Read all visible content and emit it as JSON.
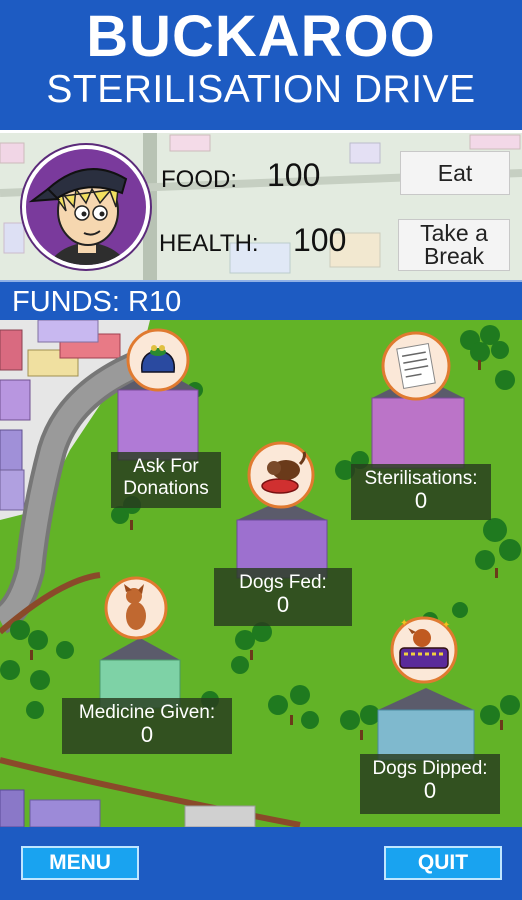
{
  "header": {
    "title": "BUCKAROO",
    "subtitle": "STERILISATION DRIVE"
  },
  "stats": {
    "food_label": "FOOD:",
    "food_value": "100",
    "health_label": "HEALTH:",
    "health_value": "100",
    "eat_label": "Eat",
    "break_line1": "Take a",
    "break_line2": "Break"
  },
  "funds": "FUNDS: R10",
  "buildings": {
    "donations_line1": "Ask For",
    "donations_line2": "Donations",
    "sterilisations_label": "Sterilisations:",
    "sterilisations_value": "0",
    "dogs_fed_label": "Dogs Fed:",
    "dogs_fed_value": "0",
    "medicine_label": "Medicine Given:",
    "medicine_value": "0",
    "dipped_label": "Dogs Dipped:",
    "dipped_value": "0"
  },
  "footer": {
    "menu_label": "MENU",
    "quit_label": "QUIT"
  }
}
